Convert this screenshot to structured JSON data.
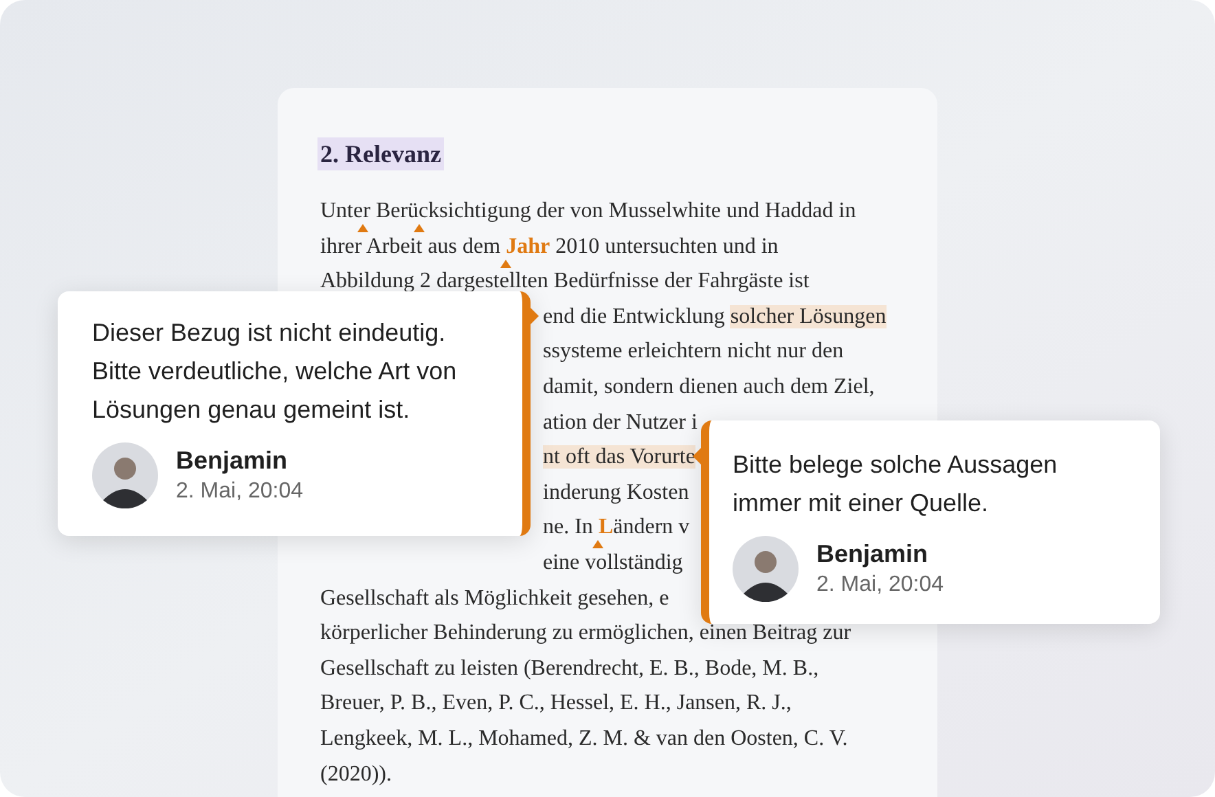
{
  "document": {
    "heading": "2. Relevanz",
    "lines": [
      {
        "kind": "full",
        "segments": [
          {
            "text": "Unte",
            "kind": "plain",
            "caret": false
          },
          {
            "text": "r Berü",
            "kind": "plain",
            "caret": true
          },
          {
            "text": "cksichtigung der von Musselwhite und Haddad in",
            "kind": "plain",
            "caret": true
          }
        ]
      },
      {
        "kind": "full",
        "segments": [
          {
            "text": "ihrer Arbeit aus dem ",
            "kind": "plain",
            "caret": false
          },
          {
            "text": "Jahr",
            "kind": "accent",
            "caret": true
          },
          {
            "text": " 2010 untersuchten und in",
            "kind": "plain",
            "caret": false
          }
        ]
      },
      {
        "kind": "full",
        "segments": [
          {
            "text": "Abbildung 2 dargestellten Bedürfnisse der Fahrgäste ist",
            "kind": "plain",
            "caret": false
          }
        ]
      },
      {
        "kind": "after_comment",
        "segments": [
          {
            "text": "end die Entwicklung ",
            "kind": "plain",
            "caret": false
          },
          {
            "text": "solcher Lösungen",
            "kind": "highlight",
            "caret": false
          }
        ]
      },
      {
        "kind": "after_comment",
        "segments": [
          {
            "text": "ssysteme erleichtern nicht nur den",
            "kind": "plain",
            "caret": false
          }
        ]
      },
      {
        "kind": "after_comment",
        "segments": [
          {
            "text": "damit, sondern dienen auch dem Ziel,",
            "kind": "plain",
            "caret": false
          }
        ]
      },
      {
        "kind": "after_comment",
        "segments": [
          {
            "text": "ation der Nutzer i",
            "kind": "plain",
            "caret": false
          }
        ]
      },
      {
        "kind": "after_comment",
        "segments": [
          {
            "text": "nt oft das Vorurte",
            "kind": "highlight",
            "caret": false
          }
        ]
      },
      {
        "kind": "after_comment",
        "segments": [
          {
            "text": "inderung Kosten",
            "kind": "plain",
            "caret": false
          }
        ]
      },
      {
        "kind": "after_comment",
        "segments": [
          {
            "text": "ne. In ",
            "kind": "plain",
            "caret": false
          },
          {
            "text": "L",
            "kind": "accent",
            "caret": true
          },
          {
            "text": "ändern v",
            "kind": "plain",
            "caret": false
          }
        ]
      },
      {
        "kind": "after_comment",
        "segments": [
          {
            "text": "eine vollständig",
            "kind": "plain",
            "caret": false
          }
        ]
      },
      {
        "kind": "full",
        "segments": [
          {
            "text": "Gesellschaft als Möglichkeit gesehen, e",
            "kind": "plain",
            "caret": false
          }
        ]
      },
      {
        "kind": "full",
        "segments": [
          {
            "text": "körperlicher Behinderung zu ermöglichen, einen Beitrag zur",
            "kind": "plain",
            "caret": false
          }
        ]
      },
      {
        "kind": "full",
        "segments": [
          {
            "text": "Gesellschaft zu leisten (Berendrecht, E. B., Bode, M. B.,",
            "kind": "plain",
            "caret": false
          }
        ]
      },
      {
        "kind": "full",
        "segments": [
          {
            "text": "Breuer, P. B., Even, P. C., Hessel, E. H., Jansen, R. J.,",
            "kind": "plain",
            "caret": false
          }
        ]
      },
      {
        "kind": "full",
        "segments": [
          {
            "text": "Lengkeek, M. L., Mohamed, Z. M. & van den Oosten, C. V.",
            "kind": "plain",
            "caret": false
          }
        ]
      },
      {
        "kind": "full",
        "segments": [
          {
            "text": "(2020)).",
            "kind": "plain",
            "caret": false
          }
        ]
      }
    ]
  },
  "comments": [
    {
      "text": "Dieser Bezug ist nicht eindeutig. Bitte verdeutliche, welche Art von Lösungen genau gemeint ist.",
      "author": "Benjamin",
      "time": "2. Mai, 20:04"
    },
    {
      "text": "Bitte belege solche Aussagen immer mit einer Quelle.",
      "author": "Benjamin",
      "time": "2. Mai, 20:04"
    }
  ]
}
